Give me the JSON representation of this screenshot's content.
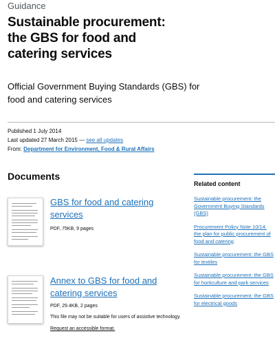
{
  "page": {
    "caption": "Guidance",
    "title": "Sustainable procurement: the GBS for food and catering services",
    "lede": "Official Government Buying Standards (GBS) for food and catering services"
  },
  "metadata": {
    "published": "Published 1 July 2014",
    "last_updated_prefix": "Last updated 27 March 2015 — ",
    "see_all_updates": "see all updates",
    "from_label": "From:",
    "from_org": "Department for Environment, Food & Rural Affairs"
  },
  "documents": {
    "heading": "Documents",
    "items": [
      {
        "title": "GBS for food and catering services",
        "meta": "PDF, 75KB, 9 pages",
        "notice": "",
        "request_link": ""
      },
      {
        "title": "Annex to GBS for food and catering services",
        "meta": "PDF, 29.4KB, 2 pages",
        "notice": "This file may not be suitable for users of assistive technology.",
        "request_link": "Request an accessible format."
      }
    ]
  },
  "related": {
    "heading": "Related content",
    "links": [
      "Sustainable procurement: the Government Buying Standards (GBS)",
      "Procurement Policy Note 10/14: the plan for public procurement of food and catering",
      "Sustainable procurement: the GBS for textiles",
      "Sustainable procurement: the GBS for horticulture and park services",
      "Sustainable procurement: the GBS for electrical goods"
    ]
  },
  "colors": {
    "link": "#1d70b8",
    "text": "#0b0c0c",
    "secondary": "#505a5f",
    "border": "#b1b4b6"
  }
}
